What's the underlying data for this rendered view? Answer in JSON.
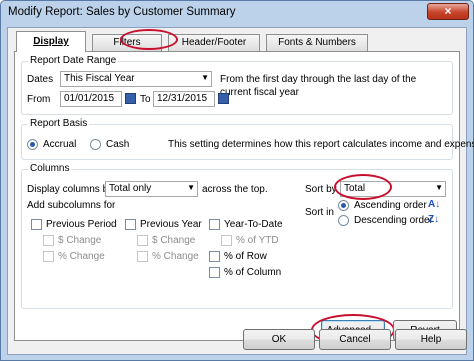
{
  "window": {
    "title": "Modify Report: Sales by Customer Summary",
    "close_glyph": "×"
  },
  "tabs": [
    {
      "label": "Display",
      "active": true
    },
    {
      "label": "Filters",
      "active": false
    },
    {
      "label": "Header/Footer",
      "active": false
    },
    {
      "label": "Fonts & Numbers",
      "active": false
    }
  ],
  "report_date_range": {
    "group_label": "Report Date Range",
    "dates_label": "Dates",
    "dates_value": "This Fiscal Year",
    "description": "From the first day through the last day of the current fiscal year",
    "from_label": "From",
    "from_value": "01/01/2015",
    "to_label": "To",
    "to_value": "12/31/2015"
  },
  "report_basis": {
    "group_label": "Report Basis",
    "accrual_label": "Accrual",
    "cash_label": "Cash",
    "selected": "Accrual",
    "description": "This setting determines how this report calculates income and expenses."
  },
  "columns": {
    "group_label": "Columns",
    "display_columns_label": "Display columns by",
    "display_columns_value": "Total only",
    "across_label": "across the top.",
    "add_subcolumns_label": "Add subcolumns for",
    "previous_period": {
      "label": "Previous Period",
      "checked": false
    },
    "dollar_change_1": {
      "label": "$ Change",
      "enabled": false
    },
    "pct_change_1": {
      "label": "% Change",
      "enabled": false
    },
    "previous_year": {
      "label": "Previous Year",
      "checked": false
    },
    "dollar_change_2": {
      "label": "$ Change",
      "enabled": false
    },
    "pct_change_2": {
      "label": "% Change",
      "enabled": false
    },
    "year_to_date": {
      "label": "Year-To-Date",
      "checked": false
    },
    "pct_ytd": {
      "label": "% of YTD",
      "enabled": false
    },
    "pct_row": {
      "label": "% of Row",
      "checked": false
    },
    "pct_column": {
      "label": "% of Column",
      "checked": false
    },
    "sort_by_label": "Sort by",
    "sort_by_value": "Total",
    "sort_in_label": "Sort in",
    "ascending_label": "Ascending order",
    "descending_label": "Descending order",
    "sort_selected": "Ascending order"
  },
  "buttons": {
    "advanced": "Advanced...",
    "revert": "Revert",
    "ok": "OK",
    "cancel": "Cancel",
    "help": "Help"
  },
  "accent_colors": {
    "highlight": "#c8102e",
    "title_bar": "#bcd2ea"
  }
}
